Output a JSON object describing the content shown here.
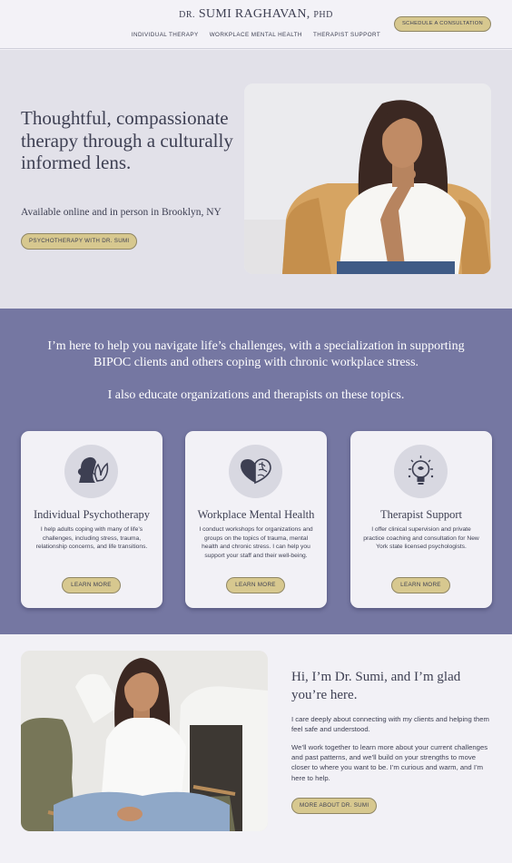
{
  "brand": {
    "prefix": "DR.",
    "name": "SUMI RAGHAVAN,",
    "suffix": "PHD",
    "accent": "#d7c88f",
    "band_color": "#7577a2"
  },
  "nav": {
    "items": [
      "INDIVIDUAL THERAPY",
      "WORKPLACE MENTAL HEALTH",
      "THERAPIST SUPPORT"
    ],
    "cta": "SCHEDULE A CONSULTATION"
  },
  "hero": {
    "title": "Thoughtful, compassionate therapy through a culturally informed lens.",
    "subtitle": "Available online and in person in Brooklyn, NY",
    "button": "PSYCHOTHERAPY WITH DR. SUMI"
  },
  "intro": {
    "line1": "I’m here to help you navigate life’s challenges, with a specialization in supporting BIPOC clients and others coping with chronic workplace stress.",
    "line2": "I also educate organizations and therapists on these topics."
  },
  "services": [
    {
      "icon": "head-flower-icon",
      "title": "Individual Psychotherapy",
      "description": "I help adults coping with many of life’s challenges, including stress, trauma, relationship concerns, and life transitions.",
      "button": "LEARN MORE"
    },
    {
      "icon": "heart-brain-icon",
      "title": "Workplace Mental Health",
      "description": "I conduct workshops for organizations and groups on the topics of trauma, mental health and chronic stress. I can help you support your staff and their well-being.",
      "button": "LEARN MORE"
    },
    {
      "icon": "lightbulb-icon",
      "title": "Therapist Support",
      "description": "I offer clinical supervision and private practice coaching and consultation for New York state licensed psychologists.",
      "button": "LEARN MORE"
    }
  ],
  "about": {
    "title": "Hi, I’m Dr. Sumi, and I’m glad you’re here.",
    "p1": "I care deeply about connecting with my clients and helping them feel safe and understood.",
    "p2": "We’ll work together to learn more about your current challenges and past patterns, and we’ll build on your strengths to move closer to where you want to be. I’m curious and warm, and I’m here to help.",
    "button": "MORE ABOUT DR. SUMI"
  }
}
